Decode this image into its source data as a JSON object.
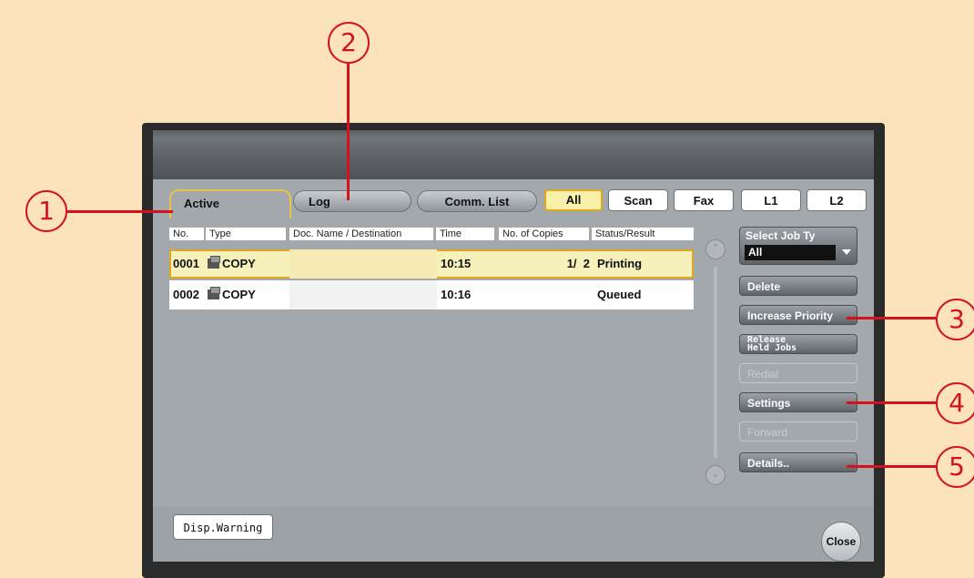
{
  "callouts": [
    "1",
    "2",
    "3",
    "4",
    "5"
  ],
  "tabs": {
    "active": "Active",
    "log": "Log",
    "comm_list": "Comm. List"
  },
  "filters": [
    "All",
    "Scan",
    "Fax",
    "L1",
    "L2"
  ],
  "selected_filter": "All",
  "table": {
    "headers": [
      "No.",
      "Type",
      "Doc. Name / Destination",
      "Time",
      "No. of Copies",
      "Status/Result"
    ],
    "rows": [
      {
        "no": "0001",
        "type": "COPY",
        "doc": "",
        "time": "10:15",
        "copies": "1/  2",
        "status": "Printing",
        "selected": true
      },
      {
        "no": "0002",
        "type": "COPY",
        "doc": "",
        "time": "10:16",
        "copies": "",
        "status": "Queued",
        "selected": false
      }
    ]
  },
  "side_panel": {
    "select_job_label": "Select Job Ty",
    "select_job_value": "All",
    "delete": "Delete",
    "increase_priority": "Increase Priority",
    "release_line1": "Release",
    "release_line2": "Held Jobs",
    "redial": "Redial",
    "settings": "Settings",
    "forward": "Forward",
    "details": "Details.."
  },
  "footer": {
    "disp_warning": "Disp.Warning",
    "close": "Close"
  },
  "colors": {
    "background": "#fde3bc",
    "callout_red": "#d4121b",
    "selection_yellow": "#e0a820"
  }
}
